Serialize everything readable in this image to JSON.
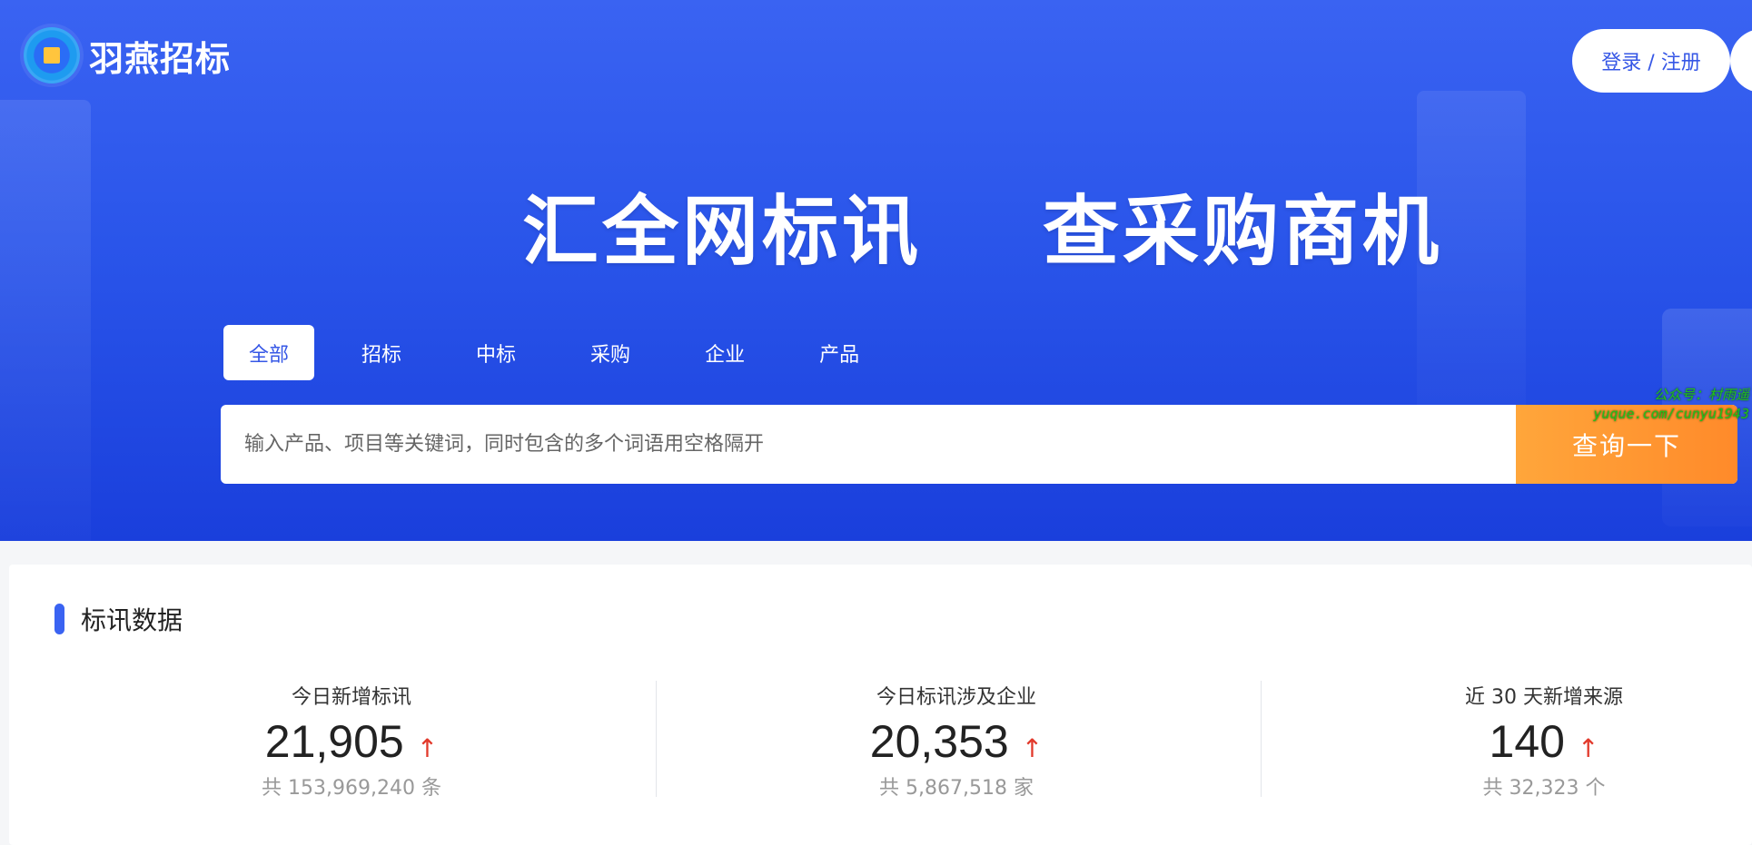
{
  "brand": {
    "name": "羽燕招标"
  },
  "header": {
    "login_label": "登录 / 注册"
  },
  "hero": {
    "headline": "汇全网标讯    查采购商机"
  },
  "tabs": [
    {
      "label": "全部",
      "active": true
    },
    {
      "label": "招标",
      "active": false
    },
    {
      "label": "中标",
      "active": false
    },
    {
      "label": "采购",
      "active": false
    },
    {
      "label": "企业",
      "active": false
    },
    {
      "label": "产品",
      "active": false
    }
  ],
  "search": {
    "placeholder": "输入产品、项目等关键词，同时包含的多个词语用空格隔开",
    "value": "",
    "button_label": "查询一下"
  },
  "watermark": {
    "line1": "公众号：村雨遥",
    "line2": "yuque.com/cunyu1943"
  },
  "stats_section": {
    "title": "标讯数据",
    "items": [
      {
        "label": "今日新增标讯",
        "value": "21,905",
        "trend": "↑",
        "total": "共 153,969,240 条"
      },
      {
        "label": "今日标讯涉及企业",
        "value": "20,353",
        "trend": "↑",
        "total": "共 5,867,518 家"
      },
      {
        "label": "近 30 天新增来源",
        "value": "140",
        "trend": "↑",
        "total": "共 32,323 个"
      }
    ]
  },
  "colors": {
    "brand_blue": "#3a63f2",
    "search_orange": "#ff8a2a",
    "trend_red": "#e23a2c"
  }
}
